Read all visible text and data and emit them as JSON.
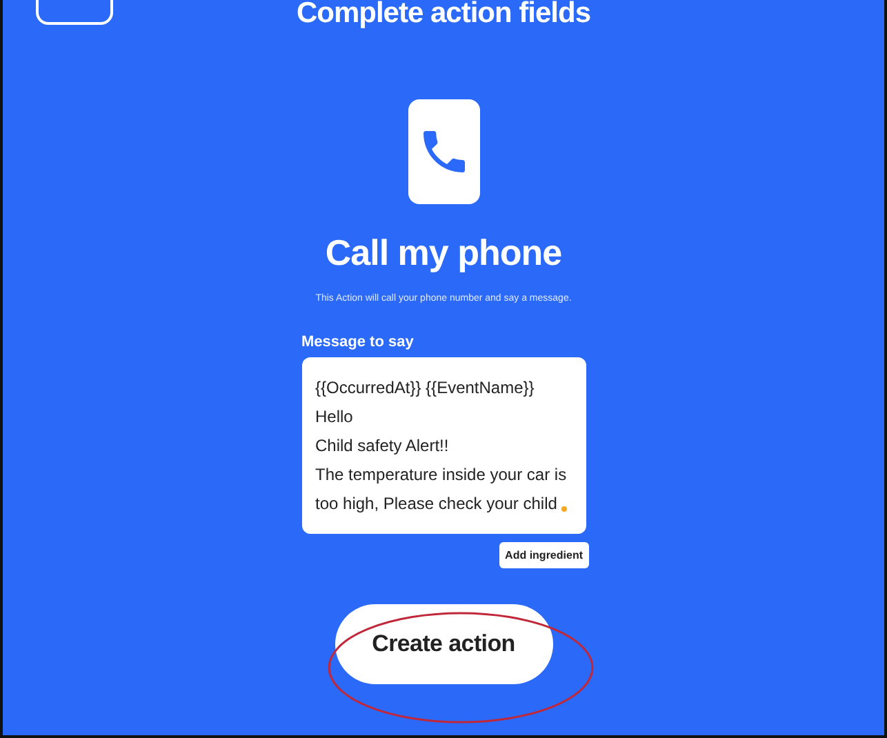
{
  "header": {
    "title": "Complete action fields"
  },
  "service": {
    "title": "Call my phone",
    "description": "This Action will call your phone number and say a message."
  },
  "message_field": {
    "label": "Message to say",
    "lines": [
      "{{OccurredAt}} {{EventName}}",
      "Hello",
      "Child safety Alert!!",
      "The temperature inside your car is",
      "too high, Please check your child"
    ]
  },
  "add_ingredient_button": {
    "label": "Add ingredient"
  },
  "create_button": {
    "label": "Create action"
  }
}
